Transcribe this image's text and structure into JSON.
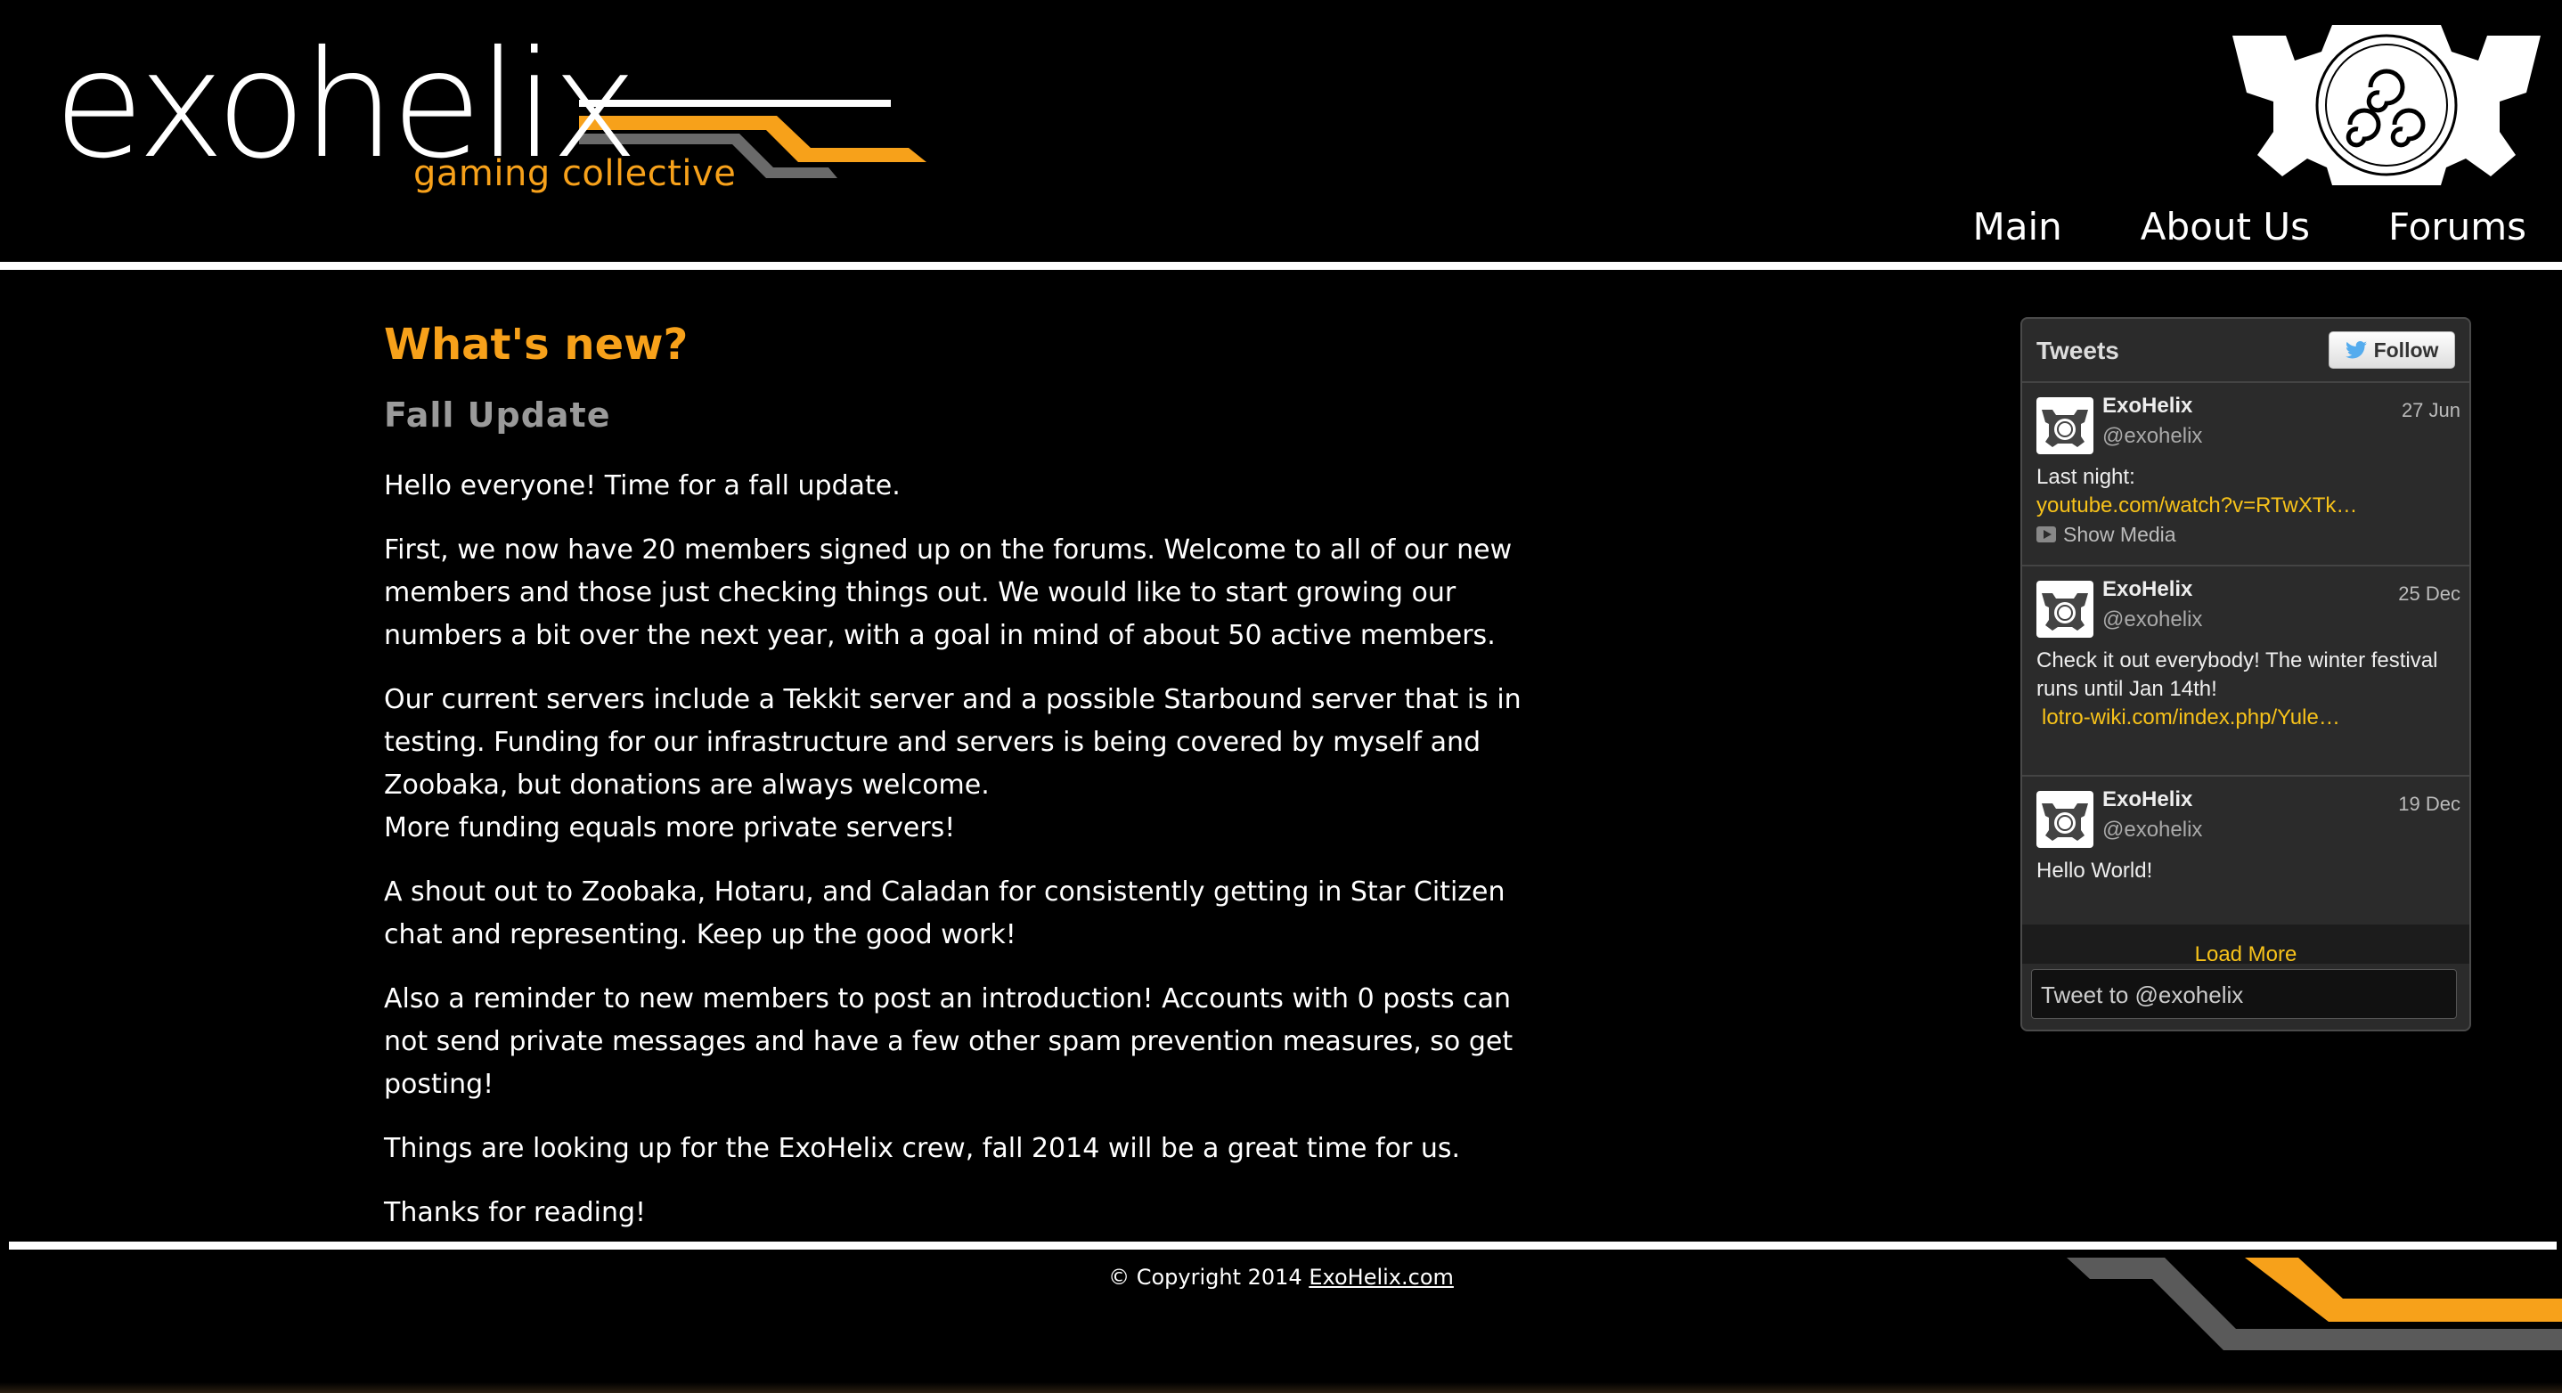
{
  "header": {
    "logo_text": "exohelix",
    "logo_tagline": "gaming collective",
    "nav": [
      "Main",
      "About Us",
      "Forums"
    ]
  },
  "article": {
    "heading": "What's new?",
    "subheading": "Fall Update",
    "paragraphs": [
      "Hello everyone! Time for a fall update.",
      "First, we now have 20 members signed up on the forums. Welcome to all of our new members and those just checking things out. We would like to start growing our numbers a bit over the next year, with a goal in mind of about 50 active members.",
      "Our current servers include a Tekkit server and a possible Starbound server that is in testing. Funding for our infrastructure and servers is being covered by myself and Zoobaka, but donations are always welcome.\nMore funding equals more private servers!",
      "A shout out to Zoobaka, Hotaru, and Caladan for consistently getting in Star Citizen chat and representing. Keep up the good work!",
      "Also a reminder to new members to post an introduction! Accounts with 0 posts can not send private messages and have a few other spam prevention measures, so get posting!",
      "Things are looking up for the ExoHelix crew, fall 2014 will be a great time for us.",
      "Thanks for reading!"
    ]
  },
  "twitter": {
    "title": "Tweets",
    "follow_label": "Follow",
    "tweets": [
      {
        "name": "ExoHelix",
        "handle": "@exohelix",
        "date": "27 Jun",
        "text": "Last night:",
        "link": "youtube.com/watch?v=RTwXTk…",
        "media": "Show Media"
      },
      {
        "name": "ExoHelix",
        "handle": "@exohelix",
        "date": "25 Dec",
        "text": "Check it out everybody!  The winter festival runs until Jan 14th!",
        "link": "lotro-wiki.com/index.php/Yule…"
      },
      {
        "name": "ExoHelix",
        "handle": "@exohelix",
        "date": "19 Dec",
        "text": "Hello World!"
      }
    ],
    "load_more": "Load More",
    "tweet_to": "Tweet to @exohelix"
  },
  "footer": {
    "copyright_prefix": "© Copyright 2014 ",
    "copyright_link": "ExoHelix.com"
  },
  "colors": {
    "accent": "#f7a11a",
    "background": "#000000",
    "link": "#f7c21a",
    "stripe_gray": "#5a5a5a"
  }
}
